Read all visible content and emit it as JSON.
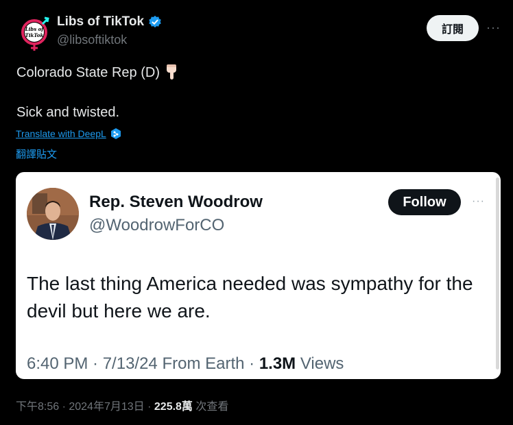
{
  "author": {
    "name": "Libs of TikTok",
    "handle": "@libsoftiktok",
    "logo_text_1": "Libs of",
    "logo_text_2": "TikTok",
    "verified_color": "#1d9bf0"
  },
  "header": {
    "subscribe_label": "訂閱",
    "more_label": "···"
  },
  "tweet": {
    "line1": "Colorado State Rep (D)",
    "line2": "Sick and twisted.",
    "translate_deepl": "Translate with DeepL",
    "translate_post": "翻譯貼文"
  },
  "quoted": {
    "name": "Rep. Steven Woodrow",
    "handle": "@WoodrowForCO",
    "follow_label": "Follow",
    "more_label": "···",
    "text": "The last thing America needed was sympathy for the devil but here we are.",
    "time": "6:40 PM · 7/13/24 From Earth ·",
    "views_count": "1.3M",
    "views_label": "Views"
  },
  "footer": {
    "time": "下午8:56 · 2024年7月13日 ·",
    "views_count": "225.8萬",
    "views_label": "次查看"
  },
  "colors": {
    "background": "#000000",
    "link": "#1d9bf0",
    "muted": "#71767b"
  }
}
